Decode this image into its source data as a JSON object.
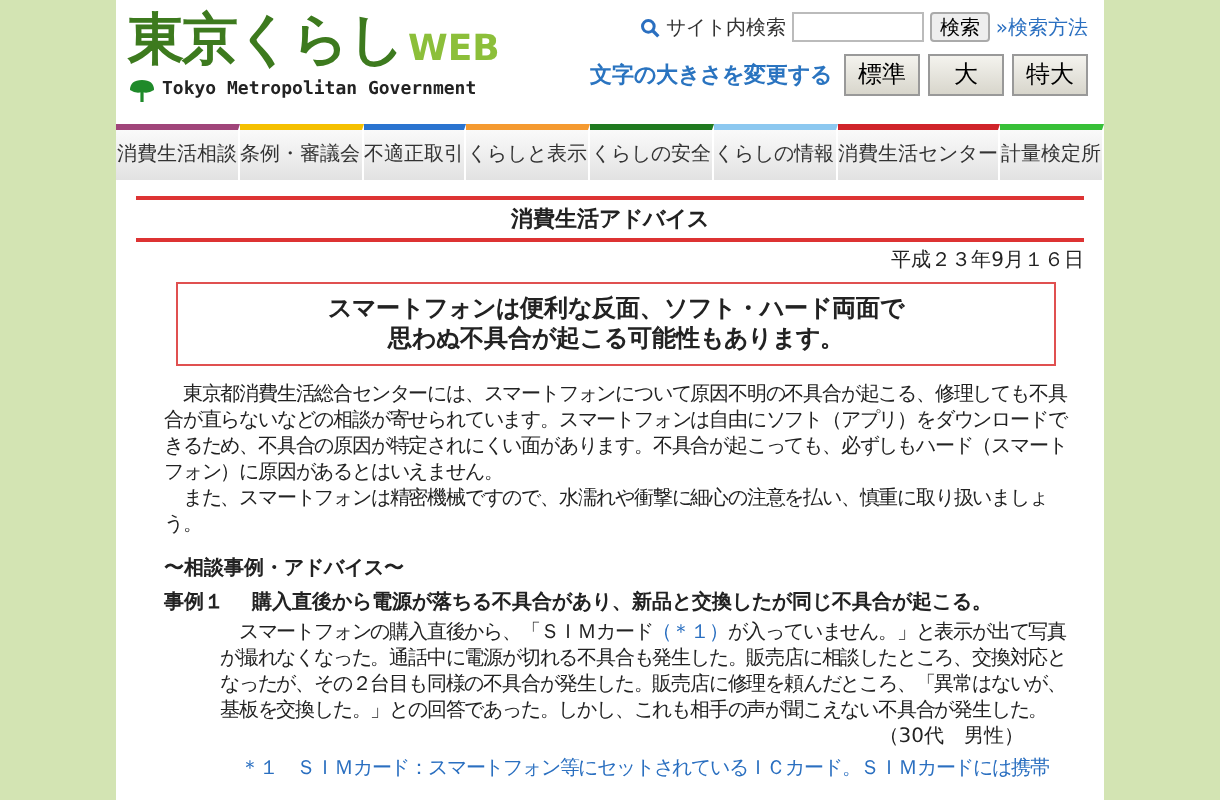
{
  "header": {
    "logo": "東京くらし",
    "logo_suffix": "WEB",
    "subtitle": "Tokyo Metropolitan Government",
    "search": {
      "label": "サイト内検索",
      "button": "検索",
      "help_link": "»検索方法"
    },
    "font_size": {
      "label": "文字の大きさを変更する",
      "buttons": [
        "標準",
        "大",
        "特大"
      ]
    }
  },
  "nav": [
    {
      "label": "消費生活相談",
      "color": "#a0457a"
    },
    {
      "label": "条例・審議会",
      "color": "#f5c000"
    },
    {
      "label": "不適正取引",
      "color": "#2a74d0"
    },
    {
      "label": "くらしと表示",
      "color": "#f59a30"
    },
    {
      "label": "くらしの安全",
      "color": "#1f7a1f"
    },
    {
      "label": "くらしの情報",
      "color": "#8cc8f0"
    },
    {
      "label": "消費生活センター",
      "color": "#d0242a"
    },
    {
      "label": "計量検定所",
      "color": "#38c038"
    }
  ],
  "page_title": "消費生活アドバイス",
  "date": "平成２３年9月１６日",
  "headline": [
    "スマートフォンは便利な反面、ソフト・ハード両面で",
    "思わぬ不具合が起こる可能性もあります。"
  ],
  "paragraphs": [
    "　東京都消費生活総合センターには、スマートフォンについて原因不明の不具合が起こる、修理しても不具合が直らないなどの相談が寄せられています。スマートフォンは自由にソフト（アプリ）をダウンロードできるため、不具合の原因が特定されにくい面があります。不具合が起こっても、必ずしもハード（スマートフォン）に原因があるとはいえません。",
    "　また、スマートフォンは精密機械ですので、水濡れや衝撃に細心の注意を払い、慎重に取り扱いましょう。"
  ],
  "section_heading": "〜相談事例・アドバイス〜",
  "cases": [
    {
      "label": "事例１",
      "title": "購入直後から電源が落ちる不具合があり、新品と交換したが同じ不具合が起こる。",
      "body_before": "　スマートフォンの購入直後から、「ＳＩＭカード",
      "note_link": "（＊１）",
      "body_after": "が入っていません。」と表示が出て写真が撮れなくなった。通話中に電源が切れる不具合も発生した。販売店に相談したところ、交換対応となったが、その２台目も同様の不具合が発生した。販売店に修理を頼んだところ、「異常はないが、基板を交換した。」との回答であった。しかし、これも相手の声が聞こえない不具合が発生した。",
      "person": "（30代　男性）"
    }
  ],
  "footnote": "＊１　ＳＩＭカード：スマートフォン等にセットされているＩＣカード。ＳＩＭカードには携帯"
}
